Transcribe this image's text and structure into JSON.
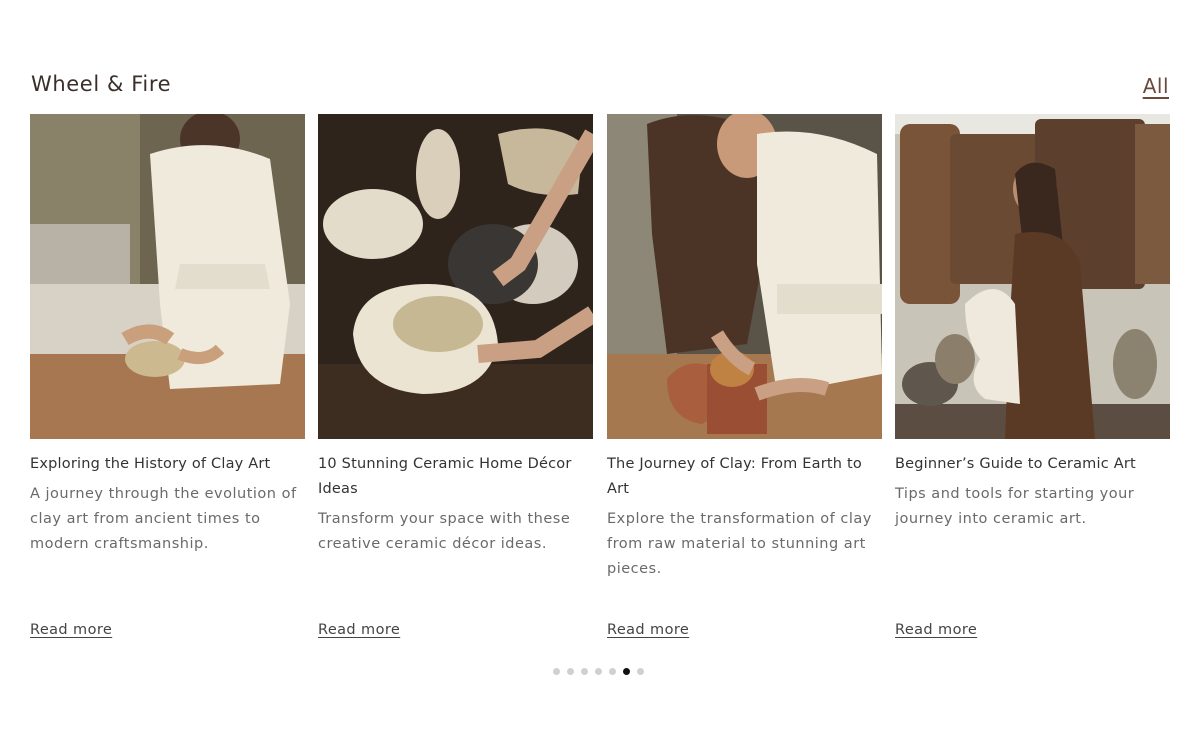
{
  "section": {
    "title": "Wheel & Fire",
    "all_link": "All"
  },
  "cards": [
    {
      "title": "Exploring the History of Clay Art",
      "description": "A journey through the evolution of clay art from ancient times to modern craftsmanship.",
      "read_more": "Read more"
    },
    {
      "title": "10 Stunning Ceramic Home Décor Ideas",
      "description": "Transform your space with these creative ceramic décor ideas.",
      "read_more": "Read more"
    },
    {
      "title": "The Journey of Clay: From Earth to Art",
      "description": "Explore the transformation of clay from raw material to stunning art pieces.",
      "read_more": "Read more"
    },
    {
      "title": "Beginner’s Guide to Ceramic Art",
      "description": "Tips and tools for starting your journey into ceramic art.",
      "read_more": "Read more"
    }
  ],
  "pagination": {
    "total": 7,
    "active_index": 5
  },
  "colors": {
    "heading": "#3b2f2b",
    "link_accent": "#6b4a3d",
    "dot_active": "#111111",
    "dot_inactive": "#d0d0d0"
  }
}
